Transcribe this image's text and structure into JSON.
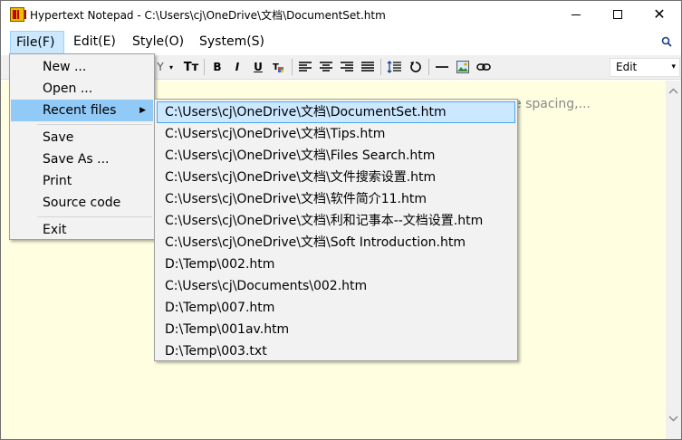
{
  "window": {
    "title": "Hypertext Notepad - C:\\Users\\cj\\OneDrive\\文档\\DocumentSet.htm",
    "minimize": "",
    "maximize": "",
    "close": "✕"
  },
  "menubar": {
    "file": "File(F)",
    "edit": "Edit(E)",
    "style": "Style(O)",
    "system": "System(S)"
  },
  "toolbar": {
    "partial_label": "Y",
    "font_size_label": "Tт",
    "bold": "B",
    "italic": "I",
    "underline": "U",
    "mode_value": "Edit"
  },
  "editor": {
    "visible_text": "e spacing,..."
  },
  "file_menu": {
    "items": [
      "New ...",
      "Open ...",
      "Recent files",
      "Save",
      "Save As ...",
      "Print",
      "Source code",
      "Exit"
    ]
  },
  "recent_files": [
    "C:\\Users\\cj\\OneDrive\\文档\\DocumentSet.htm",
    "C:\\Users\\cj\\OneDrive\\文档\\Tips.htm",
    "C:\\Users\\cj\\OneDrive\\文档\\Files Search.htm",
    "C:\\Users\\cj\\OneDrive\\文档\\文件搜索设置.htm",
    "C:\\Users\\cj\\OneDrive\\文档\\软件简介11.htm",
    "C:\\Users\\cj\\OneDrive\\文档\\利和记事本--文档设置.htm",
    "C:\\Users\\cj\\OneDrive\\文档\\Soft Introduction.htm",
    "D:\\Temp\\002.htm",
    "C:\\Users\\cj\\Documents\\002.htm",
    "D:\\Temp\\007.htm",
    "D:\\Temp\\001av.htm",
    "D:\\Temp\\003.txt"
  ],
  "colors": {
    "editor_background": "#fffee0",
    "menu_highlight": "#91c9f7",
    "submenu_highlight": "#cce8ff"
  }
}
